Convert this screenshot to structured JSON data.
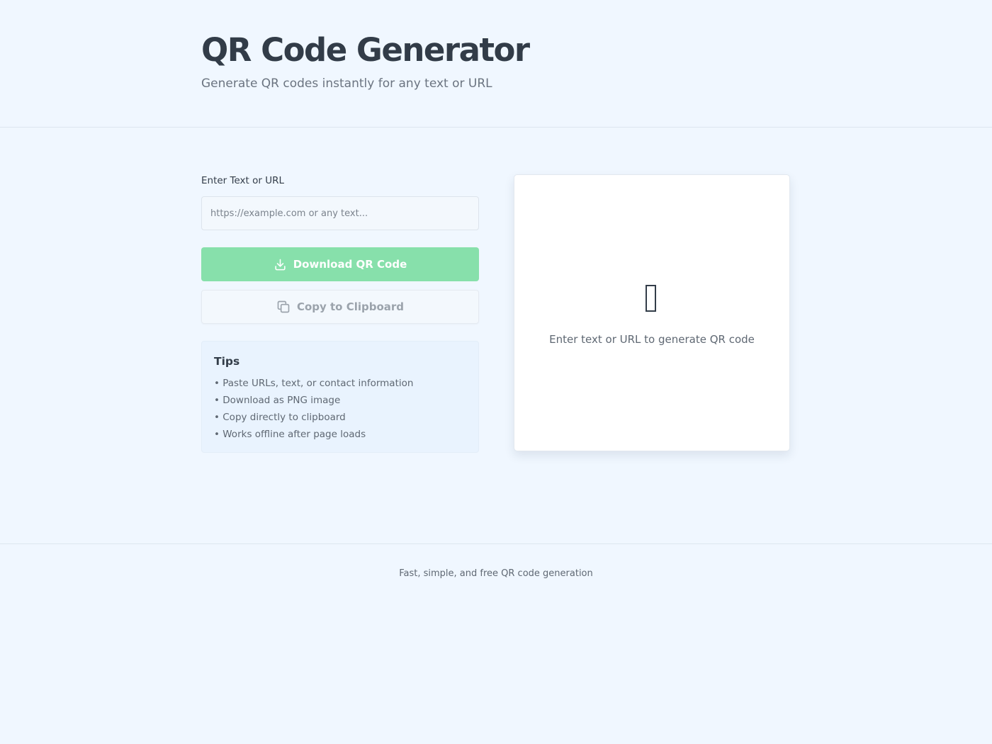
{
  "header": {
    "title": "QR Code Generator",
    "subtitle": "Generate QR codes instantly for any text or URL"
  },
  "form": {
    "label": "Enter Text or URL",
    "placeholder": "https://example.com or any text...",
    "value": "",
    "download_label": "Download QR Code",
    "download_icon": "download-icon",
    "copy_label": "Copy to Clipboard",
    "copy_icon": "copy-icon"
  },
  "tips": {
    "title": "Tips",
    "items": [
      "• Paste URLs, text, or contact information",
      "• Download as PNG image",
      "• Copy directly to clipboard",
      "• Works offline after page loads"
    ]
  },
  "preview": {
    "icon": "qr-placeholder-icon",
    "empty_text": "Enter text or URL to generate QR code"
  },
  "footer": {
    "text": "Fast, simple, and free QR code generation"
  },
  "colors": {
    "background": "#f0f7ff",
    "primary_button": "#87e0ab",
    "text_dark": "#333d49",
    "text_muted": "#5f6873"
  }
}
